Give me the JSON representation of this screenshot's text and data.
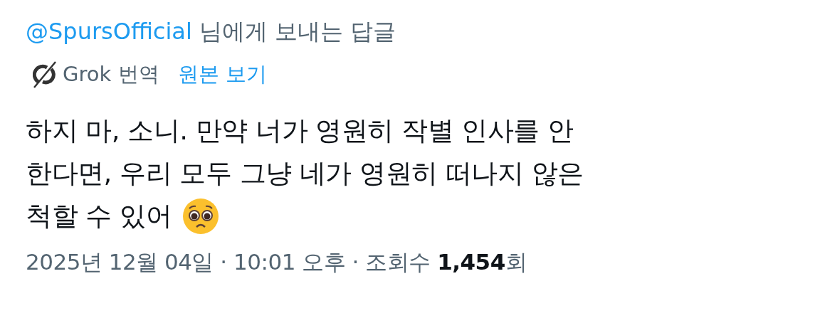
{
  "reply_context": {
    "handle": "@SpursOfficial",
    "suffix": "님에게 보내는 답글"
  },
  "translation": {
    "label": "Grok 번역",
    "link": "원본 보기"
  },
  "tweet": {
    "lines": [
      "하지 마, 소니. 만약 너가 영원히 작별 인사를 안",
      "한다면, 우리 모두 그냥 네가 영원히 떠나지 않은",
      "척할 수 있어"
    ],
    "meta": "2025년 12월 04일 · 10:01 오후 · 조회수 **1,454**회"
  }
}
